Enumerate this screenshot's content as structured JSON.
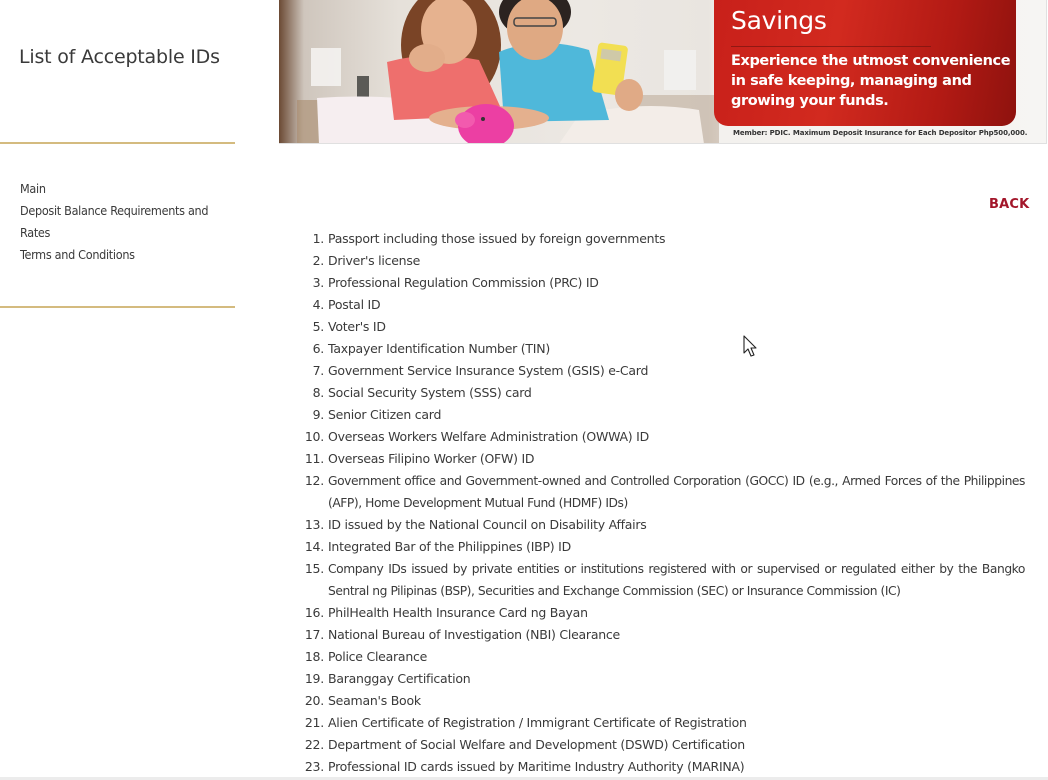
{
  "sidebar": {
    "title": "List of Acceptable IDs",
    "nav_items": [
      {
        "label": "Main"
      },
      {
        "label": "Deposit Balance Requirements and Rates"
      },
      {
        "label": "Terms and Conditions"
      }
    ]
  },
  "banner": {
    "title": "Savings",
    "tagline": "Experience the utmost convenience in safe keeping, managing and growing your funds.",
    "disclaimer": "Member: PDIC. Maximum Deposit Insurance for Each Depositor Php500,000.",
    "accent_color": "#c8201a"
  },
  "main": {
    "back_label": "BACK",
    "back_color": "#a3162a",
    "ids": [
      {
        "num": "1.",
        "text": "Passport including those issued by foreign governments"
      },
      {
        "num": "2.",
        "text": "Driver's license"
      },
      {
        "num": "3.",
        "text": "Professional Regulation Commission (PRC) ID"
      },
      {
        "num": "4.",
        "text": "Postal ID"
      },
      {
        "num": "5.",
        "text": "Voter's ID"
      },
      {
        "num": "6.",
        "text": "Taxpayer Identification Number (TIN)"
      },
      {
        "num": "7.",
        "text": "Government Service Insurance System (GSIS) e-Card"
      },
      {
        "num": "8.",
        "text": "Social Security System (SSS) card"
      },
      {
        "num": "9.",
        "text": "Senior Citizen card"
      },
      {
        "num": "10.",
        "text": "Overseas Workers Welfare Administration (OWWA) ID"
      },
      {
        "num": "11.",
        "text": "Overseas Filipino Worker (OFW) ID"
      },
      {
        "num": "12.",
        "text": "Government office and Government-owned and Controlled Corporation (GOCC) ID (e.g., Armed Forces of the Philippines (AFP), Home Development Mutual Fund (HDMF) IDs)"
      },
      {
        "num": "13.",
        "text": "ID issued by the National Council on Disability Affairs"
      },
      {
        "num": "14.",
        "text": "Integrated Bar of the Philippines (IBP) ID"
      },
      {
        "num": "15.",
        "text": "Company IDs issued by private entities or institutions registered with or supervised or regulated either by the Bangko Sentral ng Pilipinas (BSP), Securities and Exchange Commission (SEC) or Insurance Commission (IC)"
      },
      {
        "num": "16.",
        "text": "PhilHealth Health Insurance Card ng Bayan"
      },
      {
        "num": "17.",
        "text": "National Bureau of Investigation (NBI) Clearance"
      },
      {
        "num": "18.",
        "text": "Police Clearance"
      },
      {
        "num": "19.",
        "text": "Baranggay Certification"
      },
      {
        "num": "20.",
        "text": "Seaman's Book"
      },
      {
        "num": "21.",
        "text": "Alien Certificate of Registration / Immigrant Certificate of Registration"
      },
      {
        "num": "22.",
        "text": "Department of Social Welfare and Development (DSWD) Certification"
      },
      {
        "num": "23.",
        "text": "Professional ID cards issued by Maritime Industry Authority (MARINA)"
      }
    ]
  }
}
